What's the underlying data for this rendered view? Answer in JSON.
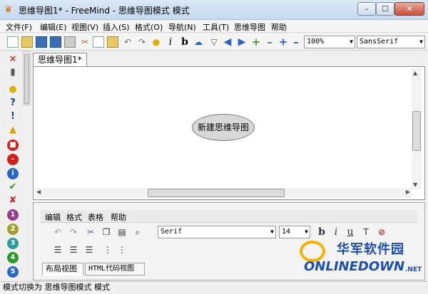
{
  "window": {
    "title": "思维导图1* - FreeMind - 思维导图模式 模式",
    "controls": {
      "minimize": "–",
      "maximize": "☐",
      "close": "✕"
    }
  },
  "menubar": {
    "items": [
      "文件(F)",
      "编辑(E)",
      "视图(V)",
      "插入(S)",
      "格式(O)",
      "导航(N)",
      "工具(T)",
      "思维导图",
      "帮助"
    ]
  },
  "toolbar": {
    "zoom_value": "100%",
    "font_value": "SansSerif",
    "icons": [
      "new-icon",
      "open-icon",
      "save-icon",
      "save-as-icon",
      "print-icon",
      "cut-icon",
      "copy-icon",
      "paste-icon",
      "undo-icon",
      "redo-icon",
      "bulb-icon",
      "italic-icon",
      "bold-icon",
      "cloud-icon",
      "filter-icon",
      "back-icon",
      "forward-icon",
      "fold-icon",
      "unfold-icon",
      "zoom-in-icon",
      "zoom-out-icon"
    ]
  },
  "palette": {
    "icons": [
      "remove-last-icon",
      "remove-all-icon",
      "idea-icon",
      "question-icon",
      "important-icon",
      "warning-icon",
      "stop-icon",
      "no-entry-icon",
      "info-icon",
      "ok-icon",
      "not-ok-icon",
      "priority-1-icon",
      "priority-2-icon",
      "priority-3-icon",
      "priority-4-icon",
      "priority-5-icon"
    ]
  },
  "tabs": [
    {
      "label": "思维导图1*"
    }
  ],
  "map": {
    "root_node": "新建思维导图"
  },
  "editor": {
    "menu": [
      "编辑",
      "格式",
      "表格",
      "帮助"
    ],
    "font_value": "Serif",
    "size_value": "14",
    "tabs": [
      {
        "label": "布局视图"
      },
      {
        "label": "HTML代码视图"
      }
    ]
  },
  "status": {
    "text": "模式切换为 思维导图模式 模式"
  },
  "watermark": {
    "zh": "华军软件园",
    "en": "ONLINEDOWN",
    "suffix": ".NET"
  },
  "colors": {
    "titlebar": "#c4d8ee",
    "close_button": "#c8503a",
    "node_fill": "#d8d8d8",
    "watermark_blue": "#1d4fb0",
    "watermark_ring": "#f2b400"
  }
}
